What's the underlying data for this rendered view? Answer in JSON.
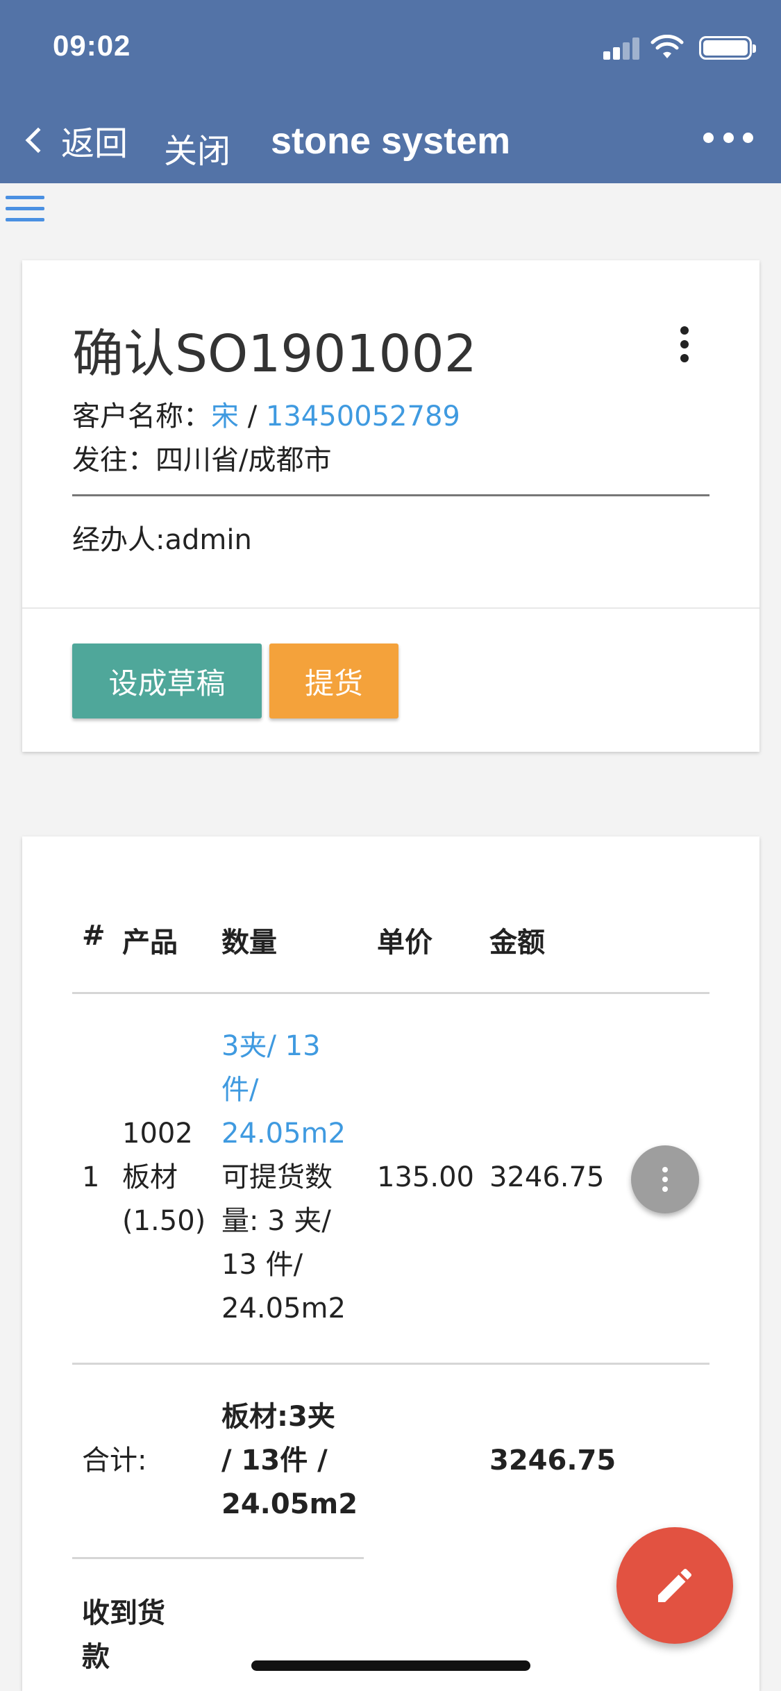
{
  "status_bar": {
    "time": "09:02"
  },
  "nav": {
    "back_label": "返回",
    "close_label": "关闭",
    "title": "stone system"
  },
  "order": {
    "title": "确认SO1901002",
    "customer_label": "客户名称：",
    "customer_name": "宋",
    "separator": " / ",
    "customer_phone": "13450052789",
    "ship_to": "发往：四川省/成都市",
    "handler": "经办人:admin",
    "draft_button": "设成草稿",
    "pickup_button": "提货"
  },
  "table": {
    "headers": [
      "#",
      "产品",
      "数量",
      "单价",
      "金额"
    ],
    "rows": [
      {
        "index": "1",
        "product_lines": [
          "1002",
          "板材",
          "(1.50)"
        ],
        "qty_lines": [
          "3夹/ 13",
          "件/",
          "24.05m2"
        ],
        "available_lines": [
          "可提货数",
          "量: 3 夹/",
          "13 件/",
          "24.05m2"
        ],
        "unit_price": "135.00",
        "amount": "3246.75"
      }
    ],
    "total_label": "合计:",
    "total_qty_lines": [
      "板材:3夹",
      "/ 13件 /",
      "24.05m2"
    ],
    "total_amount": "3246.75",
    "payment_label_lines": [
      "收到货",
      "款"
    ]
  },
  "colors": {
    "header": "#5373a7",
    "link": "#3f9ae0",
    "draft": "#4fa79a",
    "pickup": "#f4a23b",
    "fab": "#e25241"
  },
  "icons": {
    "back": "chevron-left-icon",
    "more": "more-horizontal-icon",
    "menu": "hamburger-menu-icon",
    "fab": "pencil-icon"
  }
}
